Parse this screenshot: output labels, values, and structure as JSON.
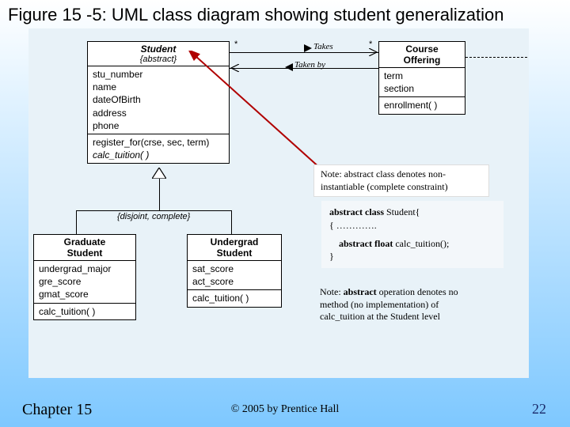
{
  "title": "Figure 15 -5: UML class diagram showing student generalization",
  "student": {
    "name": "Student",
    "stereotype": "{abstract}",
    "attrs": [
      "stu_number",
      "name",
      "dateOfBirth",
      "address",
      "phone"
    ],
    "ops": [
      "register_for(crse, sec, term)",
      "calc_tuition( )"
    ]
  },
  "course": {
    "name": "Course\nOffering",
    "attrs": [
      "term",
      "section"
    ],
    "ops": [
      "enrollment( )"
    ]
  },
  "grad": {
    "name": "Graduate\nStudent",
    "attrs": [
      "undergrad_major",
      "gre_score",
      "gmat_score"
    ],
    "ops": [
      "calc_tuition( )"
    ]
  },
  "ugrad": {
    "name": "Undergrad\nStudent",
    "attrs": [
      "sat_score",
      "act_score"
    ],
    "ops": [
      "calc_tuition( )"
    ]
  },
  "assoc": {
    "takes": "Takes",
    "takenby": "Taken by",
    "mult_left": "*",
    "mult_right": "*"
  },
  "gen_constraint": "{disjoint, complete}",
  "note1": {
    "l1": "Note: abstract class denotes non-",
    "l2": "instantiable (complete constraint)"
  },
  "code": {
    "l1_a": "abstract class ",
    "l1_b": "Student{",
    "l2": "{  ………….",
    "l3": "   abstract float calc_tuition();",
    "l4": "}"
  },
  "note2": {
    "l1_a": "Note: ",
    "l1_b": "abstract",
    "l1_c": " operation denotes no",
    "l2": "method (no implementation) of",
    "l3": "calc_tuition at the Student level"
  },
  "footer": {
    "chapter": "Chapter 15",
    "copyright": "© 2005 by Prentice Hall",
    "page": "22"
  }
}
